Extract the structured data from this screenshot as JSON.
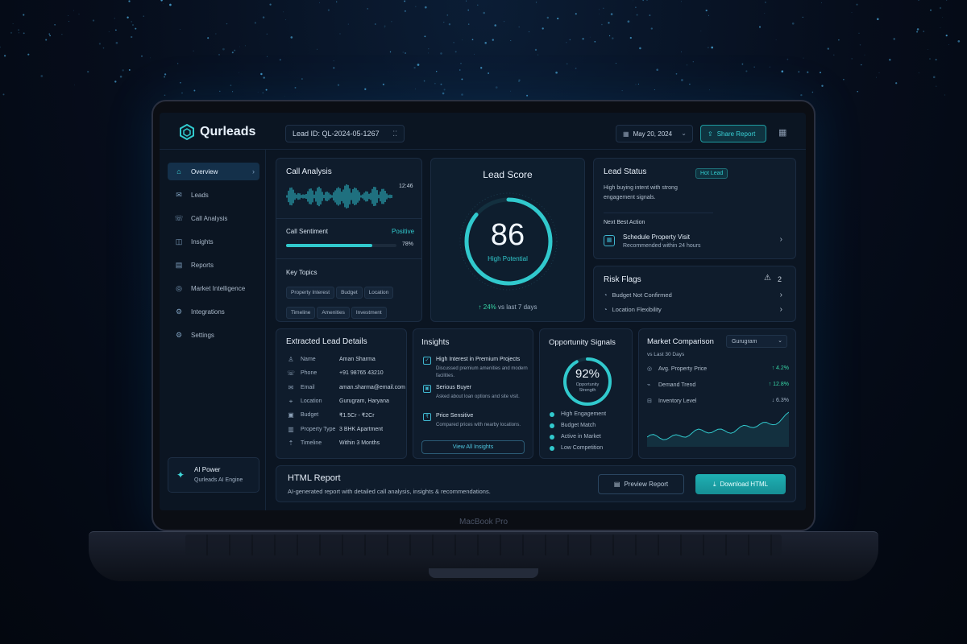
{
  "app": {
    "name": "Qurleads",
    "lead_id": "Lead ID: QL-2024-05-1267",
    "date": "May 20, 2024",
    "share": "Share Report",
    "device_label": "MacBook Pro"
  },
  "sidebar": {
    "items": [
      {
        "label": "Overview",
        "icon": "home-icon"
      },
      {
        "label": "Leads",
        "icon": "mail-icon"
      },
      {
        "label": "Call Analysis",
        "icon": "phone-icon"
      },
      {
        "label": "Insights",
        "icon": "insights-icon"
      },
      {
        "label": "Reports",
        "icon": "reports-icon"
      },
      {
        "label": "Market Intelligence",
        "icon": "market-icon"
      },
      {
        "label": "Integrations",
        "icon": "integrations-icon"
      },
      {
        "label": "Settings",
        "icon": "gear-icon"
      }
    ],
    "ai_title": "AI Power",
    "ai_sub": "Qurleads AI Engine"
  },
  "call_analysis": {
    "title": "Call Analysis",
    "duration": "12:46",
    "sentiment_label": "Call Sentiment",
    "sentiment": "Positive",
    "sentiment_pct": "78%",
    "sentiment_value": 0.78,
    "topics_title": "Key Topics",
    "topics": [
      "Property Interest",
      "Budget",
      "Location",
      "Timeline",
      "Amenities",
      "Investment"
    ]
  },
  "lead_score": {
    "title": "Lead Score",
    "score": "86",
    "score_value": 86,
    "label": "High Potential",
    "change": "24%",
    "change_text": "vs last 7 days"
  },
  "lead_status": {
    "title": "Lead Status",
    "badge": "Hot Lead",
    "desc_1": "High buying intent with strong",
    "desc_2": "engagement signals.",
    "nba_title": "Next Best Action",
    "nba_action": "Schedule Property Visit",
    "nba_sub": "Recommended within 24 hours"
  },
  "risk": {
    "title": "Risk Flags",
    "count": "2",
    "items": [
      "Budget Not Confirmed",
      "Location Flexibility"
    ]
  },
  "details": {
    "title": "Extracted Lead Details",
    "rows": [
      {
        "label": "Name",
        "value": "Aman Sharma",
        "icon": "user-icon"
      },
      {
        "label": "Phone",
        "value": "+91 98765 43210",
        "icon": "phone-icon"
      },
      {
        "label": "Email",
        "value": "aman.sharma@email.com",
        "icon": "mail-icon"
      },
      {
        "label": "Location",
        "value": "Gurugram, Haryana",
        "icon": "pin-icon"
      },
      {
        "label": "Budget",
        "value": "₹1.5Cr - ₹2Cr",
        "icon": "wallet-icon"
      },
      {
        "label": "Property Type",
        "value": "3 BHK Apartment",
        "icon": "building-icon"
      },
      {
        "label": "Timeline",
        "value": "Within 3 Months",
        "icon": "timeline-icon"
      }
    ]
  },
  "insights": {
    "title": "Insights",
    "items": [
      {
        "title": "High Interest in Premium Projects",
        "desc": "Discussed premium amenities and modern facilities."
      },
      {
        "title": "Serious Buyer",
        "desc": "Asked about loan options and site visit."
      },
      {
        "title": "Price Sensitive",
        "desc": "Compared prices with nearby locations."
      }
    ],
    "button": "View All Insights"
  },
  "opportunity": {
    "title": "Opportunity Signals",
    "pct": "92%",
    "pct_value": 0.92,
    "sub_1": "Opportunity",
    "sub_2": "Strength",
    "signals": [
      "High Engagement",
      "Budget Match",
      "Active in Market",
      "Low Competition"
    ]
  },
  "market": {
    "title": "Market Comparison",
    "location": "Gurugram",
    "period": "vs Last 30 Days",
    "rows": [
      {
        "label": "Avg. Property Price",
        "value": "4.2%",
        "dir": "up"
      },
      {
        "label": "Demand Trend",
        "value": "12.8%",
        "dir": "up"
      },
      {
        "label": "Inventory Level",
        "value": "6.3%",
        "dir": "down"
      }
    ]
  },
  "report": {
    "title": "HTML Report",
    "desc": "AI-generated report with detailed call analysis, insights & recommendations.",
    "preview": "Preview Report",
    "download": "Download HTML"
  },
  "colors": {
    "accent": "#31c9cd",
    "background": "#0b1522",
    "card": "#0f1c2c"
  }
}
